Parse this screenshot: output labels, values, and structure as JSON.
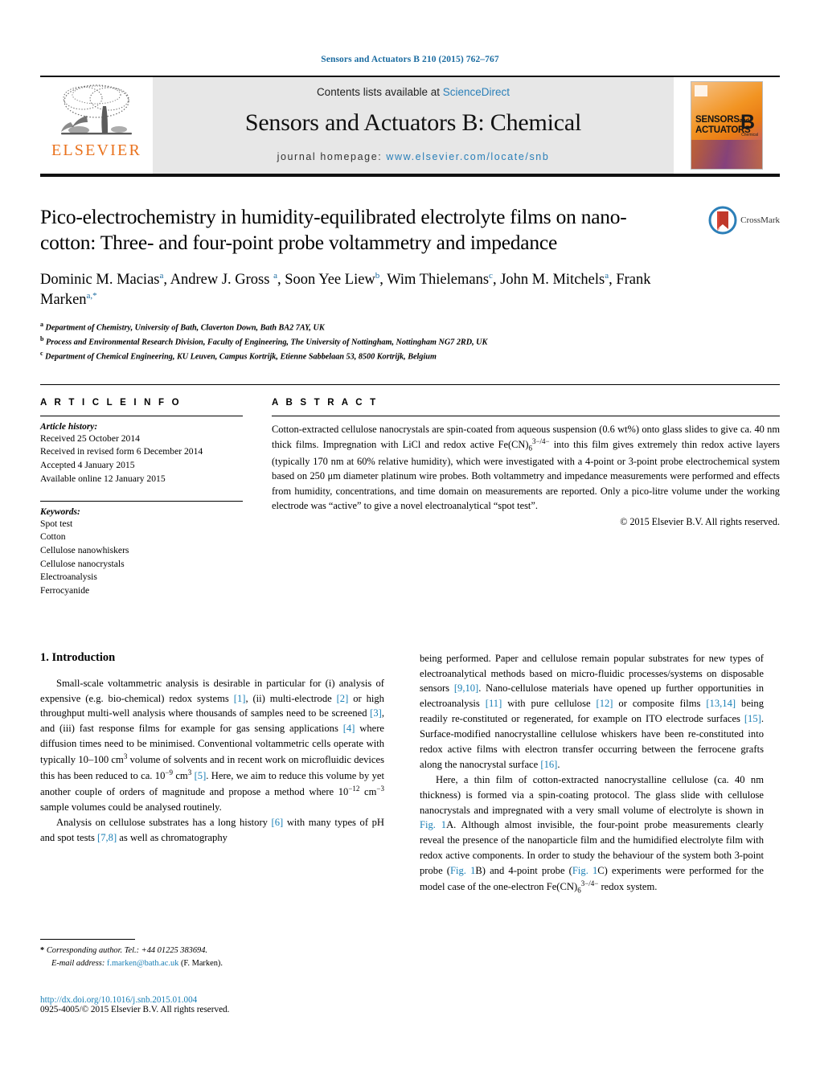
{
  "running_head": "Sensors and Actuators B 210 (2015) 762–767",
  "masthead": {
    "contents_prefix": "Contents lists available at ",
    "sciencedirect": "ScienceDirect",
    "journal_title": "Sensors and Actuators B: Chemical",
    "homepage_label": "journal homepage:",
    "homepage_url": "www.elsevier.com/locate/snb",
    "publisher_logo_text": "ELSEVIER",
    "cover": {
      "line1": "SENSORS",
      "and": "and",
      "line2": "ACTUATORS",
      "letter": "B",
      "letter_sub": "Chemical"
    }
  },
  "badge": {
    "crossmark_label": "CrossMark"
  },
  "article": {
    "title": "Pico-electrochemistry in humidity-equilibrated electrolyte films on nano-cotton: Three- and four-point probe voltammetry and impedance",
    "authors_html": "Dominic M. Macias<sup>a</sup>, Andrew J. Gross <sup>a</sup>, Soon Yee Liew<sup>b</sup>, Wim Thielemans<sup>c</sup>, John M. Mitchels<sup>a</sup>, Frank Marken<sup>a,*</sup>",
    "affiliations": [
      {
        "mark": "a",
        "text": "Department of Chemistry, University of Bath, Claverton Down, Bath BA2 7AY, UK"
      },
      {
        "mark": "b",
        "text": "Process and Environmental Research Division, Faculty of Engineering, The University of Nottingham, Nottingham NG7 2RD, UK"
      },
      {
        "mark": "c",
        "text": "Department of Chemical Engineering, KU Leuven, Campus Kortrijk, Etienne Sabbelaan 53, 8500 Kortrijk, Belgium"
      }
    ]
  },
  "article_info": {
    "heading": "A R T I C L E    I N F O",
    "history_title": "Article history:",
    "history": [
      "Received 25 October 2014",
      "Received in revised form 6 December 2014",
      "Accepted 4 January 2015",
      "Available online 12 January 2015"
    ],
    "keywords_title": "Keywords:",
    "keywords": [
      "Spot test",
      "Cotton",
      "Cellulose nanowhiskers",
      "Cellulose nanocrystals",
      "Electroanalysis",
      "Ferrocyanide"
    ]
  },
  "abstract": {
    "heading": "A B S T R A C T",
    "body_html": "Cotton-extracted cellulose nanocrystals are spin-coated from aqueous suspension (0.6 wt%) onto glass slides to give ca. 40 nm thick films. Impregnation with LiCl and redox active Fe(CN)<sub>6</sub><sup>3−/4−</sup> into this film gives extremely thin redox active layers (typically 170 nm at 60% relative humidity), which were investigated with a 4-point or 3-point probe electrochemical system based on 250 μm diameter platinum wire probes. Both voltammetry and impedance measurements were performed and effects from humidity, concentrations, and time domain on measurements are reported. Only a pico-litre volume under the working electrode was “active” to give a novel electroanalytical “spot test”.",
    "copyright": "© 2015 Elsevier B.V. All rights reserved."
  },
  "introduction": {
    "number_title": "1.  Introduction",
    "left_paragraphs_html": [
      "Small-scale voltammetric analysis is desirable in particular for (i) analysis of expensive (e.g. bio-chemical) redox systems <span class=\"lnk\">[1]</span>, (ii) multi-electrode <span class=\"lnk\">[2]</span> or high throughput multi-well analysis where thousands of samples need to be screened <span class=\"lnk\">[3]</span>, and (iii) fast response films for example for gas sensing applications <span class=\"lnk\">[4]</span> where diffusion times need to be minimised. Conventional voltammetric cells operate with typically 10–100 cm<sup>3</sup> volume of solvents and in recent work on microfluidic devices this has been reduced to ca. 10<sup>−9</sup> cm<sup>3</sup> <span class=\"lnk\">[5]</span>. Here, we aim to reduce this volume by yet another couple of orders of magnitude and propose a method where 10<sup>−12</sup> cm<sup>−3</sup> sample volumes could be analysed routinely.",
      "Analysis on cellulose substrates has a long history <span class=\"lnk\">[6]</span> with many types of pH and spot tests <span class=\"lnk\">[7,8]</span> as well as chromatography"
    ],
    "right_paragraphs_html": [
      "being performed. Paper and cellulose remain popular substrates for new types of electroanalytical methods based on micro-fluidic processes/systems on disposable sensors <span class=\"lnk\">[9,10]</span>. Nano-cellulose materials have opened up further opportunities in electroanalysis <span class=\"lnk\">[11]</span> with pure cellulose <span class=\"lnk\">[12]</span> or composite films <span class=\"lnk\">[13,14]</span> being readily re-constituted or regenerated, for example on ITO electrode surfaces <span class=\"lnk\">[15]</span>. Surface-modified nanocrystalline cellulose whiskers have been re-constituted into redox active films with electron transfer occurring between the ferrocene grafts along the nanocrystal surface <span class=\"lnk\">[16]</span>.",
      "Here, a thin film of cotton-extracted nanocrystalline cellulose (ca. 40 nm thickness) is formed via a spin-coating protocol. The glass slide with cellulose nanocrystals and impregnated with a very small volume of electrolyte is shown in <span class=\"lnk\">Fig. 1</span>A. Although almost invisible, the four-point probe measurements clearly reveal the presence of the nanoparticle film and the humidified electrolyte film with redox active components. In order to study the behaviour of the system both 3-point probe (<span class=\"lnk\">Fig. 1</span>B) and 4-point probe (<span class=\"lnk\">Fig. 1</span>C) experiments were performed for the model case of the one-electron Fe(CN)<sub>6</sub><sup>3−/4−</sup> redox system."
    ]
  },
  "footnotes": {
    "corresponding_html": "<b>*</b>  <span class=\"ital\">Corresponding author. Tel.: +44 01225 383694.</span>",
    "email_html": "<span class=\"ital\">E-mail address:</span> <span class=\"lnk\">f.marken@bath.ac.uk</span> (F. Marken)."
  },
  "footer": {
    "doi": "http://dx.doi.org/10.1016/j.snb.2015.01.004",
    "issn_line": "0925-4005/© 2015 Elsevier B.V. All rights reserved."
  }
}
